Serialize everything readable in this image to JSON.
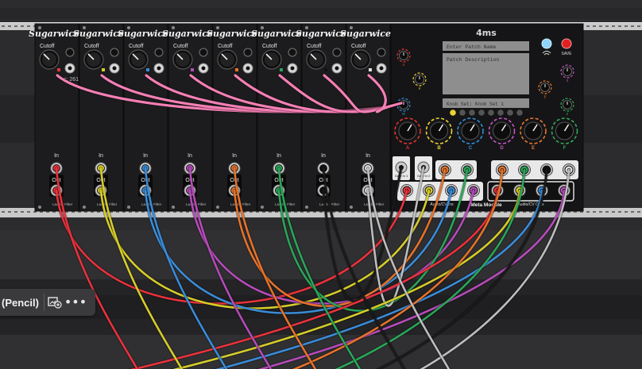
{
  "rack": {
    "brand": "Sugarwice",
    "module_count": 8
  },
  "filter_module": {
    "brand": "Sugarwice",
    "cutoff_label": "Cutoff",
    "freq_readout": "c: 261.63 Hz",
    "in_label": "In",
    "out_label": "Out",
    "footer_label": "Ladder Filter"
  },
  "modules": [
    {
      "accent": "#e8323c"
    },
    {
      "accent": "#d6cc2a"
    },
    {
      "accent": "#3a8bd6"
    },
    {
      "accent": "#b44bb8"
    },
    {
      "accent": "#e5722a"
    },
    {
      "accent": "#2aa558"
    },
    {
      "accent": "#111111"
    },
    {
      "accent": "#e0e0e0"
    }
  ],
  "meta_module": {
    "logo": "4ms",
    "patch_name_placeholder": "Enter Patch Name",
    "patch_description_placeholder": "Patch Description",
    "knob_set_label": "Knob Set:",
    "knob_set_value": "Knob Set 1",
    "save_label": "SAVE",
    "title": "Meta Module",
    "knob_labels": [
      "A",
      "B",
      "C",
      "D",
      "E",
      "F"
    ],
    "knob_colors": [
      "#e0342e",
      "#e8d234",
      "#2f8fd9",
      "#c455c2",
      "#e5772c",
      "#2ea858"
    ],
    "small_knob_labels": [
      "u",
      "v",
      "w",
      "x",
      "y",
      "z"
    ],
    "gate_in_labels": [
      "Gate In 1",
      "Gate In 2"
    ],
    "audio_in_label": "Audio/CV Ins",
    "audio_out_label": "Audio/CV Outs"
  },
  "toolbar": {
    "tool_label": "(Pencil)",
    "add_icon": "add-to-library-icon",
    "more_icon": "more-icon"
  }
}
